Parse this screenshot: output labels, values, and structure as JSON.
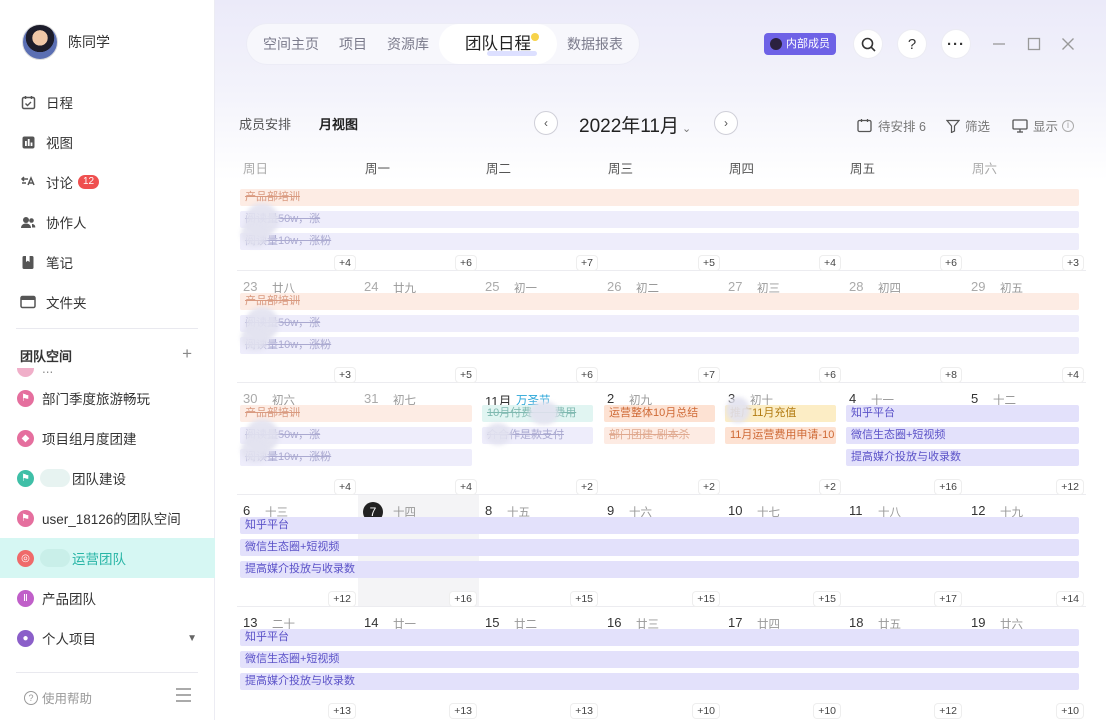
{
  "user": {
    "name": "陈同学"
  },
  "nav": [
    {
      "label": "日程",
      "icon": "calendar-icon"
    },
    {
      "label": "视图",
      "icon": "chart-icon"
    },
    {
      "label": "讨论",
      "icon": "discussion-icon",
      "badge": "12"
    },
    {
      "label": "协作人",
      "icon": "people-icon"
    },
    {
      "label": "笔记",
      "icon": "note-icon"
    },
    {
      "label": "文件夹",
      "icon": "folder-icon"
    }
  ],
  "team_section": {
    "title": "团队空间",
    "add": "+"
  },
  "teams": [
    {
      "label": "...",
      "color": "#e56f9e"
    },
    {
      "label": "部门季度旅游畅玩",
      "color": "#e56f9e"
    },
    {
      "label": "项目组月度团建",
      "color": "#e56f9e"
    },
    {
      "label": "团队建设",
      "color": "#3fbfa7"
    },
    {
      "label": "user_18126的团队空间",
      "color": "#e56f9e"
    },
    {
      "label": "运营团队",
      "color": "#ef6a6a"
    },
    {
      "label": "产品团队",
      "color": "#c05fc9"
    },
    {
      "label": "个人项目",
      "color": "#8b5fc9"
    }
  ],
  "help": {
    "label": "使用帮助"
  },
  "top_tabs": [
    "空间主页",
    "项目",
    "资源库",
    "团队日程",
    "数据报表"
  ],
  "member_badge": "内部成员",
  "toolbar": {
    "view_tabs": [
      "成员安排",
      "月视图"
    ],
    "month_title": "2022年11月",
    "pending": "待安排 6",
    "filter": "筛选",
    "display": "显示"
  },
  "weekdays": [
    "周日",
    "周一",
    "周二",
    "周三",
    "周四",
    "周五",
    "周六"
  ],
  "weeks": [
    {
      "days": [
        {
          "num": "",
          "lunar": "",
          "more": "+4"
        },
        {
          "num": "",
          "lunar": "",
          "more": "+6"
        },
        {
          "num": "",
          "lunar": "",
          "more": "+7"
        },
        {
          "num": "",
          "lunar": "",
          "more": "+5"
        },
        {
          "num": "",
          "lunar": "",
          "more": "+4"
        },
        {
          "num": "",
          "lunar": "",
          "more": "+6"
        },
        {
          "num": "",
          "lunar": "",
          "more": "+3"
        }
      ]
    },
    {
      "days": [
        {
          "num": "23",
          "lunar": "廿八",
          "more": "+3"
        },
        {
          "num": "24",
          "lunar": "廿九",
          "more": "+5"
        },
        {
          "num": "25",
          "lunar": "初一",
          "more": "+6"
        },
        {
          "num": "26",
          "lunar": "初二",
          "more": "+7"
        },
        {
          "num": "27",
          "lunar": "初三",
          "more": "+6"
        },
        {
          "num": "28",
          "lunar": "初四",
          "more": "+8"
        },
        {
          "num": "29",
          "lunar": "初五",
          "more": "+4"
        }
      ]
    },
    {
      "days": [
        {
          "num": "30",
          "lunar": "初六",
          "more": "+4"
        },
        {
          "num": "31",
          "lunar": "初七",
          "more": "+4"
        },
        {
          "num": "11月",
          "lunar": "万圣节",
          "more": "+2"
        },
        {
          "num": "2",
          "lunar": "初九",
          "more": "+2"
        },
        {
          "num": "3",
          "lunar": "初十",
          "more": "+2"
        },
        {
          "num": "4",
          "lunar": "十一",
          "more": "+16"
        },
        {
          "num": "5",
          "lunar": "十二",
          "more": "+12"
        }
      ]
    },
    {
      "days": [
        {
          "num": "6",
          "lunar": "十三",
          "more": "+12"
        },
        {
          "num": "7",
          "lunar": "十四",
          "more": "+16"
        },
        {
          "num": "8",
          "lunar": "十五",
          "more": "+15"
        },
        {
          "num": "9",
          "lunar": "十六",
          "more": "+15"
        },
        {
          "num": "10",
          "lunar": "十七",
          "more": "+15"
        },
        {
          "num": "11",
          "lunar": "十八",
          "more": "+17"
        },
        {
          "num": "12",
          "lunar": "十九",
          "more": "+14"
        }
      ]
    },
    {
      "days": [
        {
          "num": "13",
          "lunar": "二十",
          "more": "+13"
        },
        {
          "num": "14",
          "lunar": "廿一",
          "more": "+13"
        },
        {
          "num": "15",
          "lunar": "廿二",
          "more": "+13"
        },
        {
          "num": "16",
          "lunar": "廿三",
          "more": "+10"
        },
        {
          "num": "17",
          "lunar": "廿四",
          "more": "+10"
        },
        {
          "num": "18",
          "lunar": "廿五",
          "more": "+12"
        },
        {
          "num": "19",
          "lunar": "廿六",
          "more": "+10"
        }
      ]
    }
  ],
  "events": {
    "training": "产品部培训",
    "reading50": "阅读量50w，涨",
    "reading10": "阅读量10w，涨粉",
    "oct_pay": "10月付费　　费用",
    "media_pay": "介合作是款支付",
    "ops_summary": "运营整体10月总结",
    "dept_team": "部门团建-剧本杀",
    "promo": "推广11月充值",
    "nov_fee": "11月运营费用申请-10",
    "zhihu": "知乎平台",
    "wechat": "微信生态圈+短视频",
    "media": "提高媒介投放与收录数"
  },
  "today": "7"
}
